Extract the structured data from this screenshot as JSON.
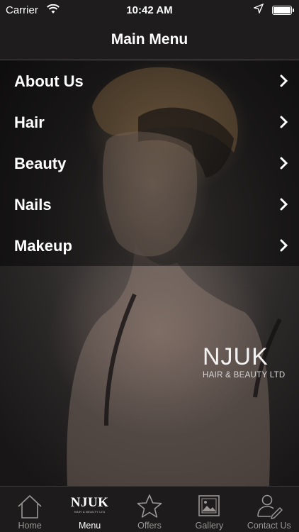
{
  "status_bar": {
    "carrier": "Carrier",
    "time": "10:42 AM"
  },
  "nav": {
    "title": "Main Menu"
  },
  "menu": {
    "items": [
      {
        "label": "About Us"
      },
      {
        "label": "Hair"
      },
      {
        "label": "Beauty"
      },
      {
        "label": "Nails"
      },
      {
        "label": "Makeup"
      }
    ]
  },
  "brand": {
    "name": "NJUK",
    "subtitle": "HAIR & BEAUTY LTD"
  },
  "tabbar": {
    "tabs": [
      {
        "label": "Home",
        "icon": "house-icon",
        "active": false
      },
      {
        "label": "Menu",
        "icon": "njuk-logo-icon",
        "active": true
      },
      {
        "label": "Offers",
        "icon": "star-icon",
        "active": false
      },
      {
        "label": "Gallery",
        "icon": "picture-icon",
        "active": false
      },
      {
        "label": "Contact Us",
        "icon": "contact-person-icon",
        "active": false
      }
    ]
  },
  "colors": {
    "bar_background": "#1e1c1c",
    "active_tab": "#ffffff",
    "inactive_tab": "#9a9696"
  }
}
